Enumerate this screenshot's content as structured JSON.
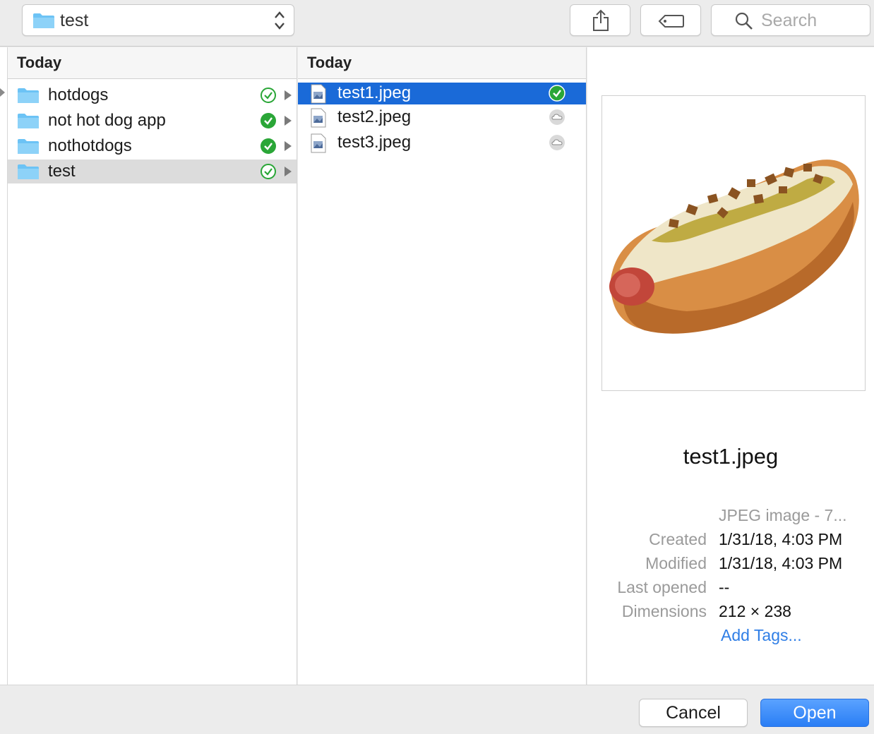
{
  "toolbar": {
    "location": "test",
    "search_placeholder": "Search"
  },
  "column1": {
    "header": "Today",
    "items": [
      {
        "label": "hotdogs",
        "status": "synced-outline"
      },
      {
        "label": "not hot dog app",
        "status": "synced-filled"
      },
      {
        "label": "nothotdogs",
        "status": "synced-filled"
      },
      {
        "label": "test",
        "status": "synced-outline"
      }
    ]
  },
  "column2": {
    "header": "Today",
    "items": [
      {
        "label": "test1.jpeg",
        "status": "synced-filled"
      },
      {
        "label": "test2.jpeg",
        "status": "cloud"
      },
      {
        "label": "test3.jpeg",
        "status": "cloud"
      }
    ]
  },
  "preview": {
    "filename": "test1.jpeg",
    "kind": "JPEG image - 7...",
    "created_label": "Created",
    "created_value": "1/31/18, 4:03 PM",
    "modified_label": "Modified",
    "modified_value": "1/31/18, 4:03 PM",
    "last_opened_label": "Last opened",
    "last_opened_value": "--",
    "dimensions_label": "Dimensions",
    "dimensions_value": "212 × 238",
    "add_tags": "Add Tags..."
  },
  "buttons": {
    "cancel": "Cancel",
    "open": "Open"
  },
  "colors": {
    "selection_blue": "#1a6ad8",
    "folder_blue": "#6cc3f5",
    "sync_green": "#2aa637",
    "link_blue": "#2f7ee6"
  }
}
